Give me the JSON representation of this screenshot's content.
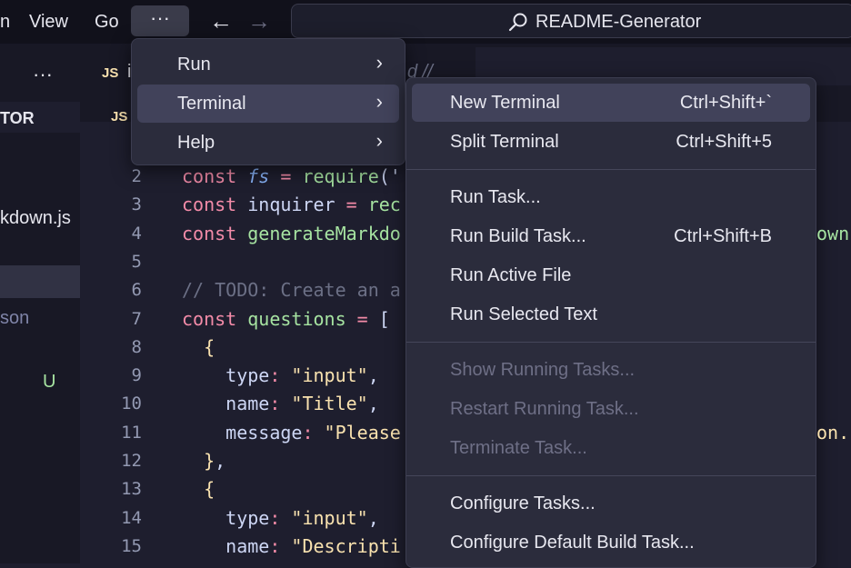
{
  "titlebar": {
    "menus": [
      "n",
      "View",
      "Go"
    ],
    "more_label": "···",
    "back_arrow": "←",
    "forward_arrow": "→",
    "search_text": "README-Generator",
    "search_icon": "search-icon"
  },
  "sidebar": {
    "more_label": "···",
    "section_label": "TOR",
    "item1": "kdown.js",
    "item2": "son",
    "badge": "U"
  },
  "tabs": {
    "tab1_icon": "JS",
    "tab1_label": "i",
    "tab1_trailing": "d //",
    "tab2_icon": "JS"
  },
  "code": {
    "line_numbers": [
      "2",
      "3",
      "4",
      "5",
      "6",
      "7",
      "8",
      "9",
      "10",
      "11",
      "12",
      "13",
      "14",
      "15"
    ],
    "lines": [
      [
        {
          "t": "const ",
          "c": "kw"
        },
        {
          "t": "fs",
          "c": "it"
        },
        {
          "t": " = ",
          "c": "kw"
        },
        {
          "t": "require",
          "c": "fn"
        },
        {
          "t": "('",
          "c": "punc"
        }
      ],
      [
        {
          "t": "const ",
          "c": "kw"
        },
        {
          "t": "inquirer",
          "c": "var"
        },
        {
          "t": " = ",
          "c": "kw"
        },
        {
          "t": "rec",
          "c": "fn"
        }
      ],
      [
        {
          "t": "const ",
          "c": "kw"
        },
        {
          "t": "generateMarkdo",
          "c": "fn"
        }
      ],
      [],
      [
        {
          "t": "// TODO: Create an a",
          "c": "cm"
        }
      ],
      [
        {
          "t": "const ",
          "c": "kw"
        },
        {
          "t": "questions",
          "c": "fn"
        },
        {
          "t": " = ",
          "c": "kw"
        },
        {
          "t": "[",
          "c": "punc"
        }
      ],
      [
        {
          "t": "  {",
          "c": "str"
        }
      ],
      [
        {
          "t": "    type",
          "c": "prop"
        },
        {
          "t": ": ",
          "c": "kw"
        },
        {
          "t": "\"input\"",
          "c": "str"
        },
        {
          "t": ",",
          "c": "punc"
        }
      ],
      [
        {
          "t": "    name",
          "c": "prop"
        },
        {
          "t": ": ",
          "c": "kw"
        },
        {
          "t": "\"Title\"",
          "c": "str"
        },
        {
          "t": ",",
          "c": "punc"
        }
      ],
      [
        {
          "t": "    message",
          "c": "prop"
        },
        {
          "t": ": ",
          "c": "kw"
        },
        {
          "t": "\"Please",
          "c": "str"
        }
      ],
      [
        {
          "t": "  }",
          "c": "str"
        },
        {
          "t": ",",
          "c": "punc"
        }
      ],
      [
        {
          "t": "  {",
          "c": "str"
        }
      ],
      [
        {
          "t": "    type",
          "c": "prop"
        },
        {
          "t": ": ",
          "c": "kw"
        },
        {
          "t": "\"input\"",
          "c": "str"
        },
        {
          "t": ",",
          "c": "punc"
        }
      ],
      [
        {
          "t": "    name",
          "c": "prop"
        },
        {
          "t": ": ",
          "c": "kw"
        },
        {
          "t": "\"Descripti",
          "c": "str"
        }
      ]
    ],
    "right_edge_line4": "own",
    "right_edge_line11": "on.\""
  },
  "main_menu": {
    "items": [
      {
        "label": "Run",
        "arrow": "›"
      },
      {
        "label": "Terminal",
        "arrow": "›"
      },
      {
        "label": "Help",
        "arrow": "›"
      }
    ]
  },
  "terminal_menu": {
    "items": [
      {
        "label": "New Terminal",
        "key": "Ctrl+Shift+`",
        "disabled": false
      },
      {
        "label": "Split Terminal",
        "key": "Ctrl+Shift+5",
        "disabled": false
      },
      {
        "label": "Run Task...",
        "key": "",
        "disabled": false
      },
      {
        "label": "Run Build Task...",
        "key": "Ctrl+Shift+B",
        "disabled": false
      },
      {
        "label": "Run Active File",
        "key": "",
        "disabled": false
      },
      {
        "label": "Run Selected Text",
        "key": "",
        "disabled": false
      },
      {
        "label": "Show Running Tasks...",
        "key": "",
        "disabled": true
      },
      {
        "label": "Restart Running Task...",
        "key": "",
        "disabled": true
      },
      {
        "label": "Terminate Task...",
        "key": "",
        "disabled": true
      },
      {
        "label": "Configure Tasks...",
        "key": "",
        "disabled": false
      },
      {
        "label": "Configure Default Build Task...",
        "key": "",
        "disabled": false
      }
    ]
  },
  "colors": {
    "accent_badge": "#a6e3a1",
    "js_icon": "#f9e2af",
    "menu_bg": "#2b2c3c",
    "highlight": "#41425a"
  }
}
